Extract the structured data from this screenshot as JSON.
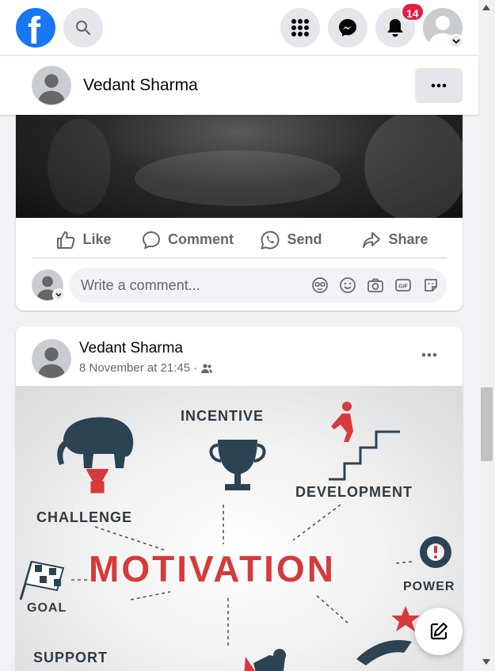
{
  "nav": {
    "logo_letter": "f",
    "notifications_count": "14"
  },
  "sticky_header": {
    "author": "Vedant Sharma"
  },
  "post1": {
    "actions": {
      "like": "Like",
      "comment": "Comment",
      "send": "Send",
      "share": "Share"
    },
    "comment_placeholder": "Write a comment..."
  },
  "post2": {
    "author": "Vedant Sharma",
    "timestamp": "8 November at 21:45",
    "separator": "·",
    "image_words": {
      "incentive": "INCENTIVE",
      "challenge": "CHALLENGE",
      "development": "DEVELOPMENT",
      "motivation": "MOTIVATION",
      "power": "POWER",
      "goal": "GOAL",
      "support": "SUPPORT"
    }
  },
  "colors": {
    "brand": "#1877f2",
    "badge": "#e41e3f",
    "motivation_red": "#d63a3a"
  }
}
